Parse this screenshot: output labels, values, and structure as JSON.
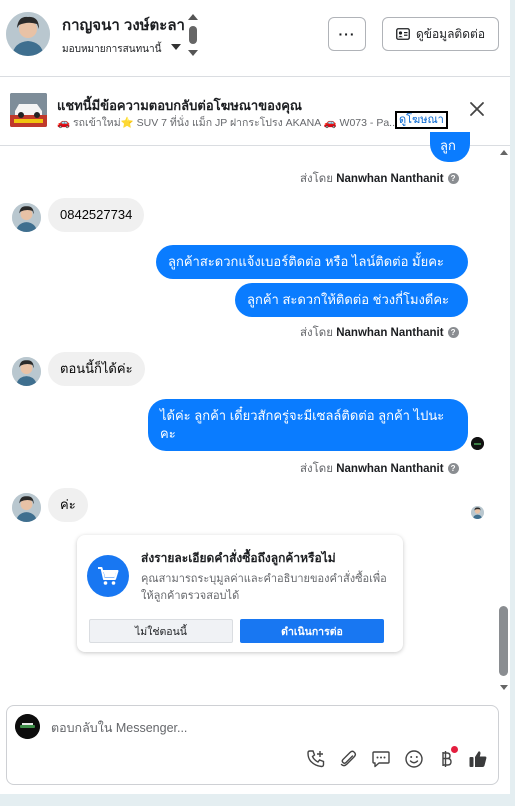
{
  "header": {
    "contact_name": "กาญจนา วงษ์ตะลา",
    "subtitle": "มอบหมายการสนทนานี้",
    "more_label": "···",
    "contact_info_label": "ดูข้อมูลติดต่อ"
  },
  "ad_banner": {
    "title": "แชทนี้มีข้อความตอบกลับต่อโฆษณาของคุณ",
    "line": "🚗 รถเข้าใหม่⭐ SUV 7 ที่นั่ง แม็ก JP ฝากระโปรง AKANA 🚗 W073 - Pa...",
    "link_label": "ดูโฆษณา"
  },
  "conversation": {
    "partial_top_bubble": "ลูก",
    "sent_by_prefix": "ส่งโดย",
    "agent_name": "Nanwhan Nanthanit",
    "messages": [
      {
        "from": "customer",
        "text": "0842527734"
      },
      {
        "from": "page",
        "text": "ลูกค้าสะดวกแจ้งเบอร์ติดต่อ หรือ ไลน์ติดต่อ มั้ยคะ"
      },
      {
        "from": "page",
        "text": "ลูกค้า สะดวกให้ติดต่อ ช่วงกี่โมงดีคะ"
      },
      {
        "from": "customer",
        "text": "ตอนนี้ก็ได้ค่ะ"
      },
      {
        "from": "page",
        "text": "ได้ค่ะ  ลูกค้า เดี๋ยวสักครู่จะมีเซลล์ติดต่อ ลูกค้า ไปนะคะ"
      },
      {
        "from": "customer",
        "text": "ค่ะ"
      }
    ]
  },
  "order_prompt": {
    "title": "ส่งรายละเอียดคำสั่งซื้อถึงลูกค้าหรือไม่",
    "description": "คุณสามารถระบุมูลค่าและคำอธิบายของคำสั่งซื้อเพื่อให้ลูกค้าตรวจสอบได้",
    "decline_label": "ไม่ใช่ตอนนี้",
    "accept_label": "ดำเนินการต่อ"
  },
  "composer": {
    "placeholder": "ตอบกลับใน Messenger...",
    "value": "",
    "tools": [
      "phone-add-icon",
      "attachment-icon",
      "saved-reply-icon",
      "emoji-icon",
      "payment-icon",
      "like-icon"
    ]
  },
  "colors": {
    "outgoing_bubble": "#0a7cff",
    "incoming_bubble": "#f0f0f0",
    "primary_button": "#1877f2",
    "notification_dot": "#e41e3f"
  }
}
